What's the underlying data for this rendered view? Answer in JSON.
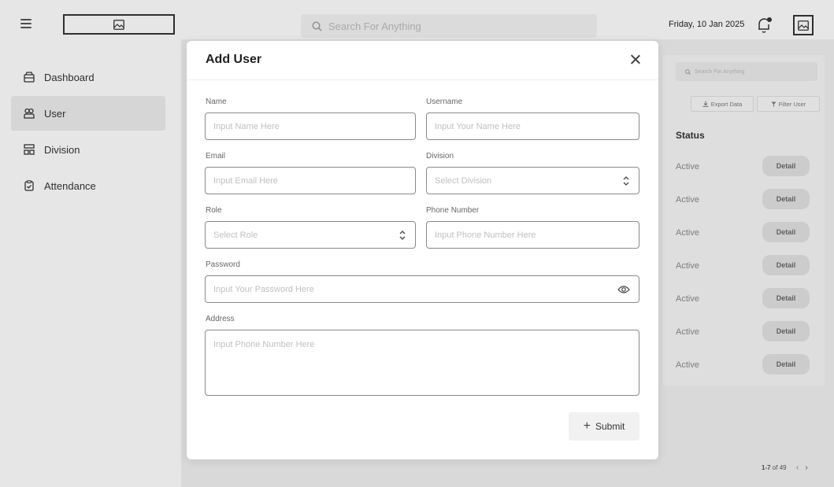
{
  "topbar": {
    "search_placeholder": "Search For Anything",
    "date": "Friday, 10 Jan 2025"
  },
  "sidebar": {
    "items": [
      {
        "label": "Dashboard",
        "icon": "dashboard-icon"
      },
      {
        "label": "User",
        "icon": "users-icon",
        "active": true
      },
      {
        "label": "Division",
        "icon": "division-icon"
      },
      {
        "label": "Attendance",
        "icon": "clipboard-icon"
      }
    ]
  },
  "right_panel": {
    "search_placeholder": "Search For Anything",
    "export_label": "Export Data",
    "filter_label": "Filter User",
    "status_header": "Status",
    "rows": [
      {
        "status": "Active",
        "action": "Detail"
      },
      {
        "status": "Active",
        "action": "Detail"
      },
      {
        "status": "Active",
        "action": "Detail"
      },
      {
        "status": "Active",
        "action": "Detail"
      },
      {
        "status": "Active",
        "action": "Detail"
      },
      {
        "status": "Active",
        "action": "Detail"
      },
      {
        "status": "Active",
        "action": "Detail"
      }
    ],
    "pager_range": "1-7",
    "pager_text": "of 49"
  },
  "modal": {
    "title": "Add User",
    "fields": {
      "name": {
        "label": "Name",
        "placeholder": "Input Name Here"
      },
      "username": {
        "label": "Username",
        "placeholder": "Input Your Name Here"
      },
      "email": {
        "label": "Email",
        "placeholder": "Input Email Here"
      },
      "division": {
        "label": "Division",
        "placeholder": "Select Division"
      },
      "role": {
        "label": "Role",
        "placeholder": "Select Role"
      },
      "phone": {
        "label": "Phone Number",
        "placeholder": "Input Phone Number Here"
      },
      "password": {
        "label": "Password",
        "placeholder": "Input Your Password Here"
      },
      "address": {
        "label": "Address",
        "placeholder": "Input Phone Number Here"
      }
    },
    "submit_label": "Submit"
  }
}
